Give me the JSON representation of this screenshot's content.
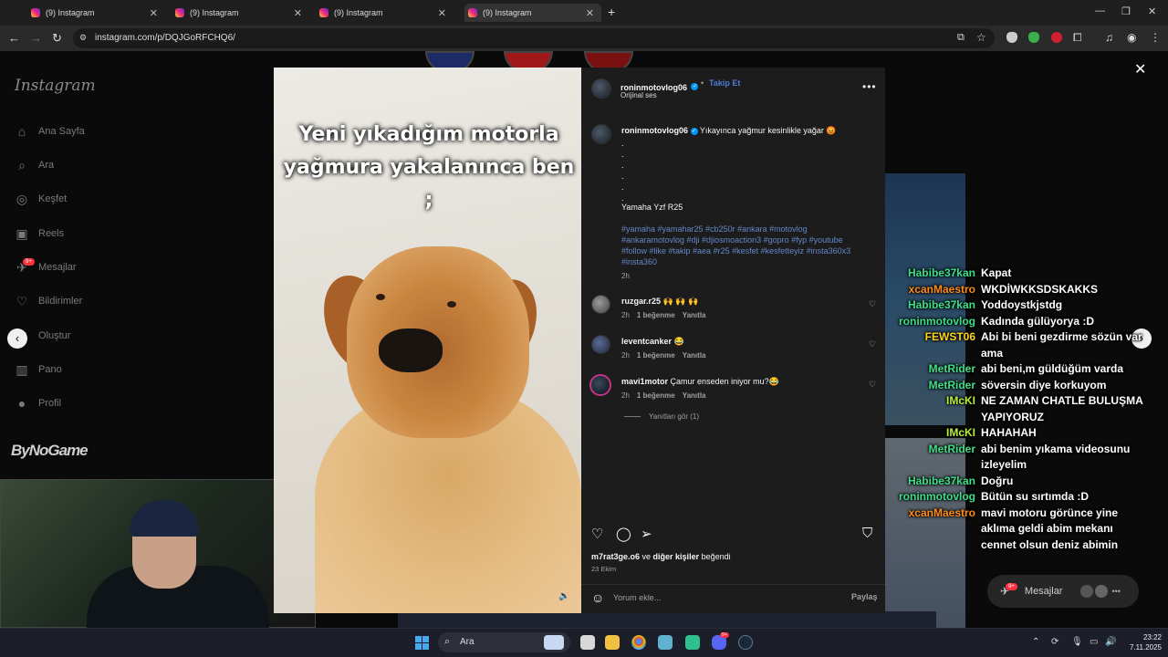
{
  "browser": {
    "tabs": [
      {
        "title": "(9) Instagram"
      },
      {
        "title": "(9) Instagram"
      },
      {
        "title": "(9) Instagram"
      },
      {
        "title": "(9) Instagram"
      }
    ],
    "new_tab": "+",
    "url": "instagram.com/p/DQJGoRFCHQ6/"
  },
  "sidebar": {
    "logo": "Instagram",
    "items": [
      {
        "label": "Ana Sayfa",
        "icon": "home-icon"
      },
      {
        "label": "Ara",
        "icon": "search-icon"
      },
      {
        "label": "Keşfet",
        "icon": "compass-icon"
      },
      {
        "label": "Reels",
        "icon": "reels-icon"
      },
      {
        "label": "Mesajlar",
        "icon": "messenger-icon",
        "badge": "9+"
      },
      {
        "label": "Bildirimler",
        "icon": "heart-icon"
      },
      {
        "label": "Oluştur",
        "icon": "plus-square-icon"
      },
      {
        "label": "Pano",
        "icon": "dashboard-icon"
      },
      {
        "label": "Profil",
        "icon": "profile-icon"
      }
    ]
  },
  "watermark": "ByNoGame",
  "post": {
    "image_caption_line1": "Yeni yıkadığım motorla",
    "image_caption_line2": "yağmura yakalanınca ben ;",
    "author": "roninmotovlog06",
    "follow_label": "Takip Et",
    "separator": "•",
    "audio": "Orijinal ses",
    "more": "•••",
    "caption_text": "Yıkayınca yağmur kesinlikle yağar 😡",
    "caption_dots": [
      ".",
      ".",
      ".",
      ".",
      ".",
      "."
    ],
    "caption_model": "Yamaha Yzf R25",
    "hashtags": "#yamaha #yamahar25 #cb250r #ankara #motovlog #ankaramotovlog #dji #djiosmoaction3 #gopro #fyp #youtube #follow #like #takip #aea #r25 #kesfet #kesfetteyiz #insta360x3 #insta360",
    "caption_time": "2h",
    "comments": [
      {
        "user": "ruzgar.r25",
        "text": "🙌 🙌 🙌",
        "time": "2h",
        "likes": "1 beğenme",
        "reply": "Yanıtla"
      },
      {
        "user": "leventcanker",
        "text": "😂",
        "time": "2h",
        "likes": "1 beğenme",
        "reply": "Yanıtla"
      },
      {
        "user": "mavi1motor",
        "text": "Çamur enseden iniyor mu?😂",
        "time": "2h",
        "likes": "1 beğenme",
        "reply": "Yanıtla"
      }
    ],
    "view_replies": "Yanıtları gör (1)",
    "liked_by_user": "m7rat3ge.o6",
    "liked_by_mid": " ve ",
    "liked_by_others": "diğer kişiler",
    "liked_by_suffix": " beğendi",
    "date": "23 Ekim",
    "comment_placeholder": "Yorum ekle...",
    "share_label": "Paylaş"
  },
  "chat": {
    "lines": [
      {
        "user": "Habibe37kan",
        "color": "#3fe08a",
        "msg": "Kapat"
      },
      {
        "user": "xcanMaestro",
        "color": "#ff8c1a",
        "msg": "WKDİWKKSDSKAKKS"
      },
      {
        "user": "Habibe37kan",
        "color": "#3fe08a",
        "msg": "Yoddoystkjstdg"
      },
      {
        "user": "roninmotovlog",
        "color": "#3fe08a",
        "msg": "Kadında gülüyorya :D"
      },
      {
        "user": "FEWST06",
        "color": "#ffd21a",
        "msg": "Abi bi beni gezdirme sözün var ama"
      },
      {
        "user": "MetRider",
        "color": "#3fe08a",
        "msg": "abi beni,m güldüğüm varda"
      },
      {
        "user": "MetRider",
        "color": "#3fe08a",
        "msg": "söversin diye korkuyom"
      },
      {
        "user": "IMcKI",
        "color": "#b8f03a",
        "msg": "NE ZAMAN CHATLE BULUŞMA YAPIYORUZ"
      },
      {
        "user": "IMcKI",
        "color": "#b8f03a",
        "msg": "HAHAHAH"
      },
      {
        "user": "MetRider",
        "color": "#3fe08a",
        "msg": "abi benim yıkama videosunu izleyelim"
      },
      {
        "user": "Habibe37kan",
        "color": "#3fe08a",
        "msg": "Doğru"
      },
      {
        "user": "roninmotovlog",
        "color": "#3fe08a",
        "msg": "Bütün su sırtımda :D"
      },
      {
        "user": "xcanMaestro",
        "color": "#ff8c1a",
        "msg": "mavi motoru görünce yine aklıma geldi abim mekanı cennet olsun deniz abimin"
      }
    ],
    "messages_pill": "Mesajlar",
    "messages_badge": "9+"
  },
  "taskbar": {
    "search": "Ara",
    "time": "23:22",
    "date": "7.11.2025"
  },
  "colors": {
    "accent_follow": "#4a7cd6",
    "hashtag": "#6487c8",
    "notification_badge": "#ff3040"
  }
}
